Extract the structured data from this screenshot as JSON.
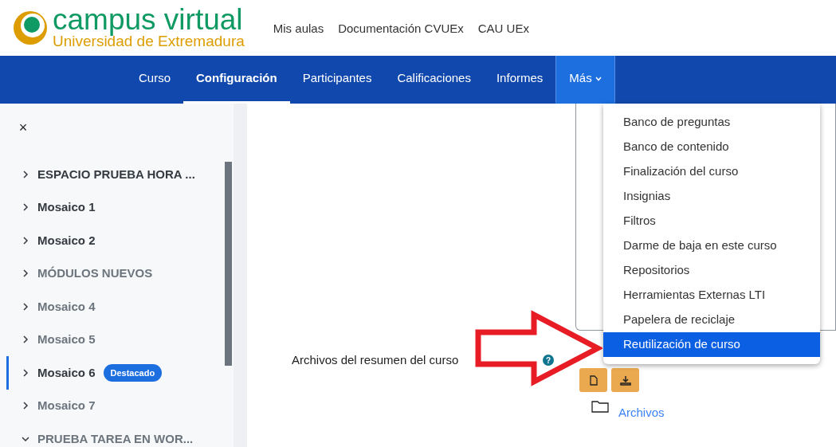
{
  "logo": {
    "title": "campus virtual",
    "subtitle": "Universidad de Extremadura"
  },
  "top_links": [
    "Mis aulas",
    "Documentación CVUEx",
    "CAU UEx"
  ],
  "nav": [
    {
      "label": "Curso",
      "selected": false,
      "kind": "tab"
    },
    {
      "label": "Configuración",
      "selected": true,
      "kind": "tab"
    },
    {
      "label": "Participantes",
      "selected": false,
      "kind": "tab"
    },
    {
      "label": "Calificaciones",
      "selected": false,
      "kind": "tab"
    },
    {
      "label": "Informes",
      "selected": false,
      "kind": "tab"
    },
    {
      "label": "Más",
      "selected": false,
      "kind": "menu",
      "expanded": true
    }
  ],
  "more_menu": [
    {
      "label": "Banco de preguntas",
      "selected": false
    },
    {
      "label": "Banco de contenido",
      "selected": false
    },
    {
      "label": "Finalización del curso",
      "selected": false
    },
    {
      "label": "Insignias",
      "selected": false
    },
    {
      "label": "Filtros",
      "selected": false
    },
    {
      "label": "Darme de baja en este curso",
      "selected": false
    },
    {
      "label": "Repositorios",
      "selected": false
    },
    {
      "label": "Herramientas Externas LTI",
      "selected": false
    },
    {
      "label": "Papelera de reciclaje",
      "selected": false
    },
    {
      "label": "Reutilización de curso",
      "selected": true
    }
  ],
  "sidebar": {
    "close": "×",
    "items": [
      {
        "label": "ESPACIO PRUEBA HORA ...",
        "dimmed": false,
        "selected": false,
        "expanded": false
      },
      {
        "label": "Mosaico 1",
        "dimmed": false,
        "selected": false,
        "expanded": false
      },
      {
        "label": "Mosaico 2",
        "dimmed": false,
        "selected": false,
        "expanded": false
      },
      {
        "label": "MÓDULOS NUEVOS",
        "dimmed": true,
        "selected": false,
        "expanded": false
      },
      {
        "label": "Mosaico 4",
        "dimmed": true,
        "selected": false,
        "expanded": false
      },
      {
        "label": "Mosaico 5",
        "dimmed": true,
        "selected": false,
        "expanded": false
      },
      {
        "label": "Mosaico 6",
        "dimmed": false,
        "selected": true,
        "expanded": false,
        "badge": "Destacado"
      },
      {
        "label": "Mosaico 7",
        "dimmed": true,
        "selected": false,
        "expanded": false
      },
      {
        "label": "PRUEBA TAREA EN WOR...",
        "dimmed": true,
        "selected": false,
        "expanded": true
      }
    ]
  },
  "form": {
    "label": "Archivos del resumen del curso",
    "help": "?",
    "folder": "Archivos"
  }
}
